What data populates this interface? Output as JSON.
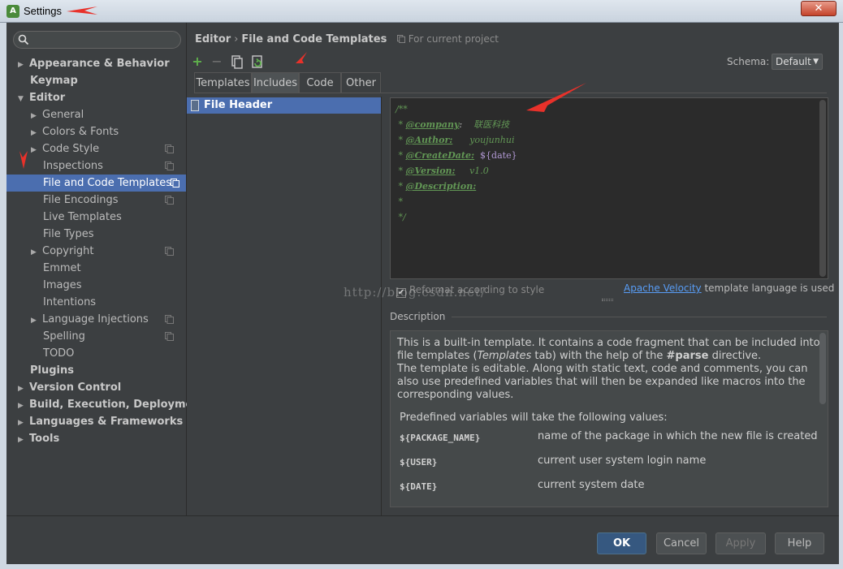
{
  "window": {
    "title": "Settings",
    "close_glyph": "✕"
  },
  "sidebar": {
    "search_placeholder": "",
    "items": [
      {
        "label": "Appearance & Behavior",
        "arrow": "▶"
      },
      {
        "label": "Keymap"
      },
      {
        "label": "Editor",
        "arrow": "▼"
      },
      {
        "label": "General",
        "arrow": "▶"
      },
      {
        "label": "Colors & Fonts",
        "arrow": "▶"
      },
      {
        "label": "Code Style",
        "arrow": "▶"
      },
      {
        "label": "Inspections"
      },
      {
        "label": "File and Code Templates"
      },
      {
        "label": "File Encodings"
      },
      {
        "label": "Live Templates"
      },
      {
        "label": "File Types"
      },
      {
        "label": "Copyright",
        "arrow": "▶"
      },
      {
        "label": "Emmet"
      },
      {
        "label": "Images"
      },
      {
        "label": "Intentions"
      },
      {
        "label": "Language Injections",
        "arrow": "▶"
      },
      {
        "label": "Spelling"
      },
      {
        "label": "TODO"
      },
      {
        "label": "Plugins"
      },
      {
        "label": "Version Control",
        "arrow": "▶"
      },
      {
        "label": "Build, Execution, Deployment",
        "arrow": "▶"
      },
      {
        "label": "Languages & Frameworks",
        "arrow": "▶"
      },
      {
        "label": "Tools",
        "arrow": "▶"
      }
    ]
  },
  "breadcrumb": {
    "section": "Editor",
    "separator": "›",
    "page": "File and Code Templates",
    "scope": "For current project"
  },
  "toolbar": {
    "add": "+",
    "remove": "−"
  },
  "schema": {
    "label": "Schema:",
    "value": "Default"
  },
  "tabs": [
    "Templates",
    "Includes",
    "Code",
    "Other"
  ],
  "templates_list": [
    "File Header"
  ],
  "editor": {
    "lines": {
      "l1": "/**",
      "l2_prefix": " * ",
      "l2_tag": "@company",
      "l2_colon": ":",
      "l2_value": "    联医科技",
      "l3_prefix": " * ",
      "l3_tag": "@Author:",
      "l3_value": "      youjunhui",
      "l4_prefix": " * ",
      "l4_tag": "@CreateDate:",
      "l4_value": "  ${date}",
      "l5_prefix": " * ",
      "l5_tag": "@Version:",
      "l5_value": "     v1.0",
      "l6_prefix": " * ",
      "l6_tag": "@Description:",
      "l7": " *",
      "l8": " */"
    }
  },
  "reformat": {
    "label": "Reformat according to style",
    "checked": "✔"
  },
  "watermark": "http://blog.csdn.net/",
  "velocity": {
    "link": "Apache Velocity",
    "suffix": " template language is used"
  },
  "description": {
    "label": "Description",
    "para1_a": "This is a built-in template. It contains a code fragment that can be included into file templates (",
    "para1_tab": "Templates",
    "para1_b": " tab) with the help of the ",
    "para1_directive": "#parse",
    "para1_c": " directive.",
    "para2": "The template is editable. Along with static text, code and comments, you can also use predefined variables that will then be expanded like macros into the corresponding values.",
    "predef": "Predefined variables will take the following values:",
    "variables": [
      {
        "name": "${PACKAGE_NAME}",
        "desc": "name of the package in which the new file is created"
      },
      {
        "name": "${USER}",
        "desc": "current user system login name"
      },
      {
        "name": "${DATE}",
        "desc": "current system date"
      }
    ]
  },
  "buttons": {
    "ok": "OK",
    "cancel": "Cancel",
    "apply": "Apply",
    "help": "Help"
  },
  "colors": {
    "accent": "#4b6eaf",
    "ok_button": "#365880",
    "annotation_arrow": "#e8312a",
    "comment_green": "#629755",
    "link": "#589df6"
  }
}
